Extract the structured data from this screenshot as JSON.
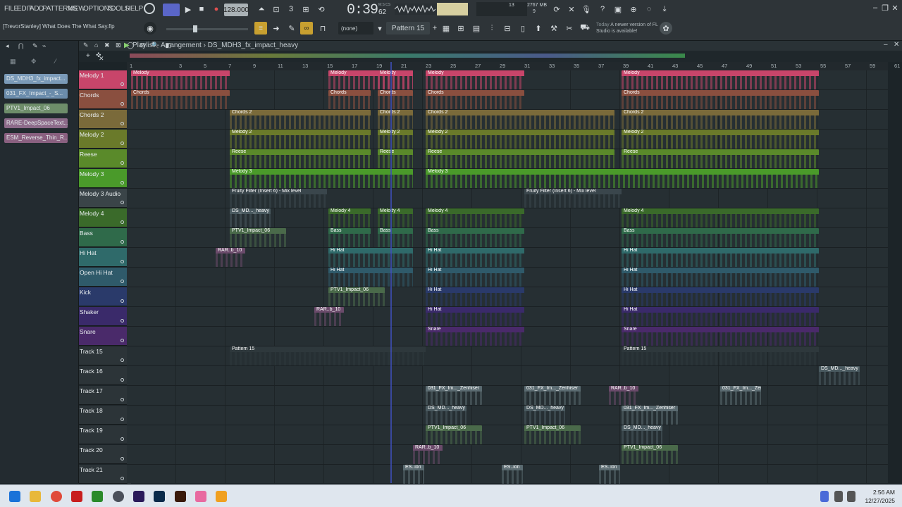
{
  "menu": [
    "FILE",
    "EDIT",
    "ADD",
    "PATTERNS",
    "VIEW",
    "OPTIONS",
    "TOOLS",
    "HELP"
  ],
  "tempo": "128.000",
  "time": "0:39",
  "time_frac": "62",
  "time_label": "M:S:CS",
  "cpu": "13",
  "memory": "2767 MB",
  "polyphony": "9",
  "project_hint": "[TrevorStanley] What Does The What Say.flp",
  "pattern": "Pattern 15",
  "none_label": "(none)",
  "news": {
    "today": "Today",
    "text": "A newer version of FL Studio is available!"
  },
  "playlist_title": "Playlist - Arrangement › DS_MDH3_fx_impact_heavy",
  "browser": [
    {
      "label": "DS_MDH3_fx_impact...",
      "color": "#7a9ab8"
    },
    {
      "label": "031_FX_Impact_-_S...",
      "color": "#6b8cab"
    },
    {
      "label": "PTV1_Impact_06",
      "color": "#6e8d6a"
    },
    {
      "label": "RARE-DeepSpaceText...",
      "color": "#8d6b8a"
    },
    {
      "label": "ESM_Reverse_Thin_R...",
      "color": "#8a6080"
    }
  ],
  "ruler": [
    "1",
    "",
    "3",
    "5",
    "7",
    "9",
    "11",
    "13",
    "15",
    "17",
    "19",
    "21",
    "23",
    "25",
    "27",
    "29",
    "31",
    "33",
    "35",
    "37",
    "39",
    "41",
    "43",
    "45",
    "47",
    "49",
    "51",
    "53",
    "55",
    "57",
    "59",
    "61"
  ],
  "tracks": [
    {
      "name": "Melody 1",
      "color": "#c8456a",
      "bar": "#e25a7a"
    },
    {
      "name": "Chords",
      "color": "#8a4f3f",
      "bar": "#d97a5a"
    },
    {
      "name": "Chords 2",
      "color": "#7a6a3a",
      "bar": "#d9a84a"
    },
    {
      "name": "Melody 2",
      "color": "#6a7a2a",
      "bar": "#b6c24a"
    },
    {
      "name": "Reese",
      "color": "#5a8a2a",
      "bar": "#8ed04a"
    },
    {
      "name": "Melody 3",
      "color": "#4a9a2a",
      "bar": "#6fd04a"
    },
    {
      "name": "Melody 3 Audio",
      "color": "#3a4448",
      "bar": "#3a4448"
    },
    {
      "name": "Melody 4",
      "color": "#3a6a2a",
      "bar": "#3a6a2a"
    },
    {
      "name": "Bass",
      "color": "#2f6a4a",
      "bar": "#5ee0e0"
    },
    {
      "name": "Hi Hat",
      "color": "#2f6a6a",
      "bar": "#5ee0e0"
    },
    {
      "name": "Open Hi Hat",
      "color": "#2f5a6a",
      "bar": "#5ee0e0"
    },
    {
      "name": "Kick",
      "color": "#2a3a6a",
      "bar": "#2a3a6a"
    },
    {
      "name": "Shaker",
      "color": "#3a2a6a",
      "bar": "#3a2a6a"
    },
    {
      "name": "Snare",
      "color": "#4a2a6a",
      "bar": "#4a2a6a"
    },
    {
      "name": "Track 15",
      "color": "#2c3438",
      "bar": "#7a8a90"
    },
    {
      "name": "Track 16",
      "color": "#2c3438",
      "bar": "#2c3438"
    },
    {
      "name": "Track 17",
      "color": "#2c3438",
      "bar": "#2c3438"
    },
    {
      "name": "Track 18",
      "color": "#2c3438",
      "bar": "#2c3438"
    },
    {
      "name": "Track 19",
      "color": "#2c3438",
      "bar": "#2c3438"
    },
    {
      "name": "Track 20",
      "color": "#2c3438",
      "bar": "#2c3438"
    },
    {
      "name": "Track 21",
      "color": "#2c3438",
      "bar": "#2c3438"
    }
  ],
  "clip_names": {
    "melody1": "Melody",
    "chords": "Chords",
    "chords2": "Chords 2",
    "melody2": "Melody 2",
    "reese": "Reese",
    "melody3": "Melody 3",
    "fruity": "Fruity Filter (Insert 6) - Mix level",
    "melody4": "Melody 4",
    "ds": "DS_MD..._heavy",
    "ptv": "PTV1_Impact_06",
    "bass": "Bass",
    "rar": "RAR..b_10",
    "hihat": "Hi Hat",
    "snare": "Snare",
    "pattern15": "Pattern 15",
    "fx031": "031_FX_Im..._Zenhiser",
    "es": "ES..ion"
  },
  "clock": {
    "time": "2:56 AM",
    "date": "12/27/2025"
  }
}
